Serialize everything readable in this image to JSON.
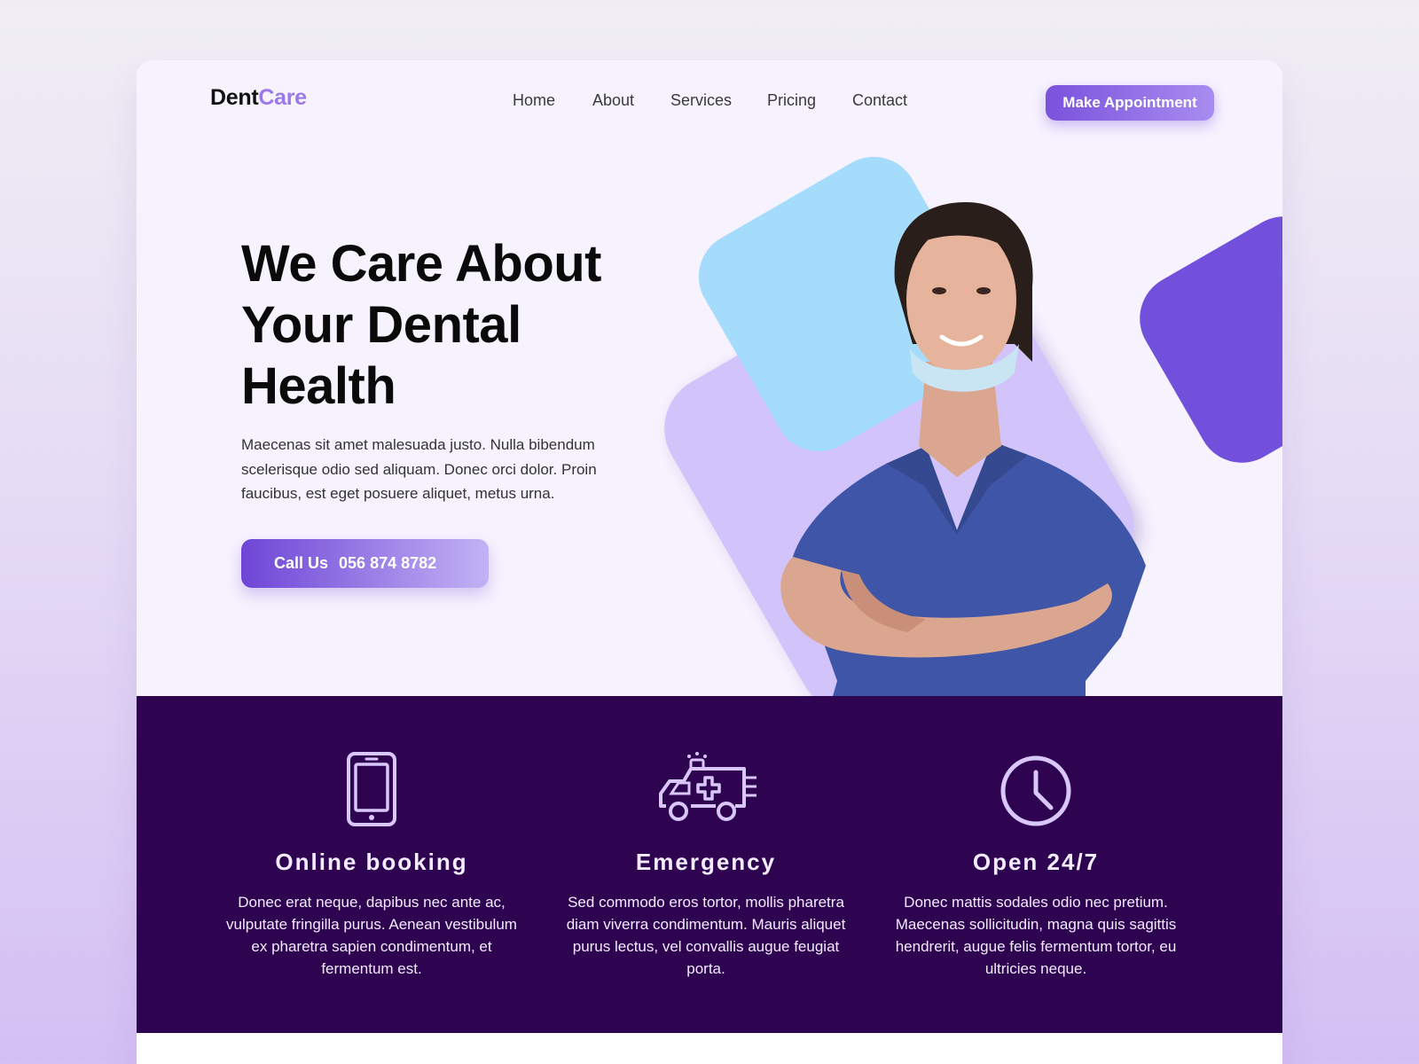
{
  "brand": {
    "part1": "Dent",
    "part2": "Care"
  },
  "nav": {
    "items": [
      "Home",
      "About",
      "Services",
      "Pricing",
      "Contact"
    ],
    "cta_label": "Make Appointment"
  },
  "hero": {
    "title": "We Care About Your Dental Health",
    "description": "Maecenas sit amet malesuada justo. Nulla bibendum scelerisque odio sed aliquam. Donec orci dolor. Proin faucibus, est eget posuere aliquet, metus urna.",
    "call_label": "Call Us",
    "call_number": "056 874 8782"
  },
  "features": [
    {
      "icon": "smartphone-icon",
      "title": "Online booking",
      "text": "Donec erat neque, dapibus nec ante ac, vulputate fringilla purus. Aenean vestibulum ex pharetra sapien condimentum, et fermentum est."
    },
    {
      "icon": "ambulance-icon",
      "title": "Emergency",
      "text": "Sed commodo eros tortor, mollis pharetra diam viverra condimentum. Mauris aliquet purus lectus, vel convallis augue feugiat porta."
    },
    {
      "icon": "clock-icon",
      "title": "Open 24/7",
      "text": "Donec mattis sodales odio nec pretium. Maecenas sollicitudin, magna quis sagittis hendrerit, augue felis fermentum tortor, eu ultricies neque."
    }
  ],
  "colors": {
    "accent": "#7a52dc",
    "accent_light": "#a98cf0",
    "features_bg": "#2e0451",
    "icon_stroke": "#d9c6fb",
    "shape_blue": "#a6dcfb",
    "shape_lavender": "#d2c4fb",
    "shape_purple": "#7350db"
  }
}
